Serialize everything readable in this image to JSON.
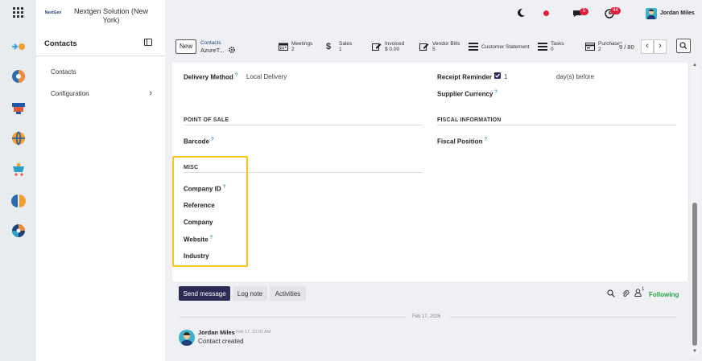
{
  "company": {
    "logo_text": "NextGen",
    "name_line1": "Nextgen Solution (New",
    "name_line2": "York)"
  },
  "sidebar": {
    "title": "Contacts",
    "items": [
      {
        "label": "Contacts"
      },
      {
        "label": "Configuration"
      }
    ]
  },
  "topbar": {
    "chat_badge": "5",
    "activity_badge": "44",
    "user_name": "Jordan Miles"
  },
  "breadcrumb": {
    "new_label": "New",
    "parent": "Contacts",
    "record": "AzureT..."
  },
  "smart_buttons": [
    {
      "label": "Meetings",
      "value": "2",
      "icon": "calendar-icon"
    },
    {
      "label": "Sales",
      "value": "1",
      "icon": "dollar-icon"
    },
    {
      "label": "Invoiced",
      "value": "$ 0.00",
      "icon": "pencil-square-icon"
    },
    {
      "label": "Vendor Bills",
      "value": "5",
      "icon": "pencil-square-icon"
    },
    {
      "label": "Customer Statement",
      "value": "",
      "icon": "list-icon"
    },
    {
      "label": "Tasks",
      "value": "0",
      "icon": "list-icon"
    },
    {
      "label": "Purchases",
      "value": "2",
      "icon": "card-icon"
    }
  ],
  "pager": {
    "text": "9 / 80"
  },
  "form": {
    "delivery_method_label": "Delivery Method",
    "delivery_method_value": "Local Delivery",
    "receipt_reminder_label": "Receipt Reminder",
    "receipt_reminder_value": "1",
    "receipt_reminder_suffix": "day(s) before",
    "supplier_currency_label": "Supplier Currency",
    "pos_section": "POINT OF SALE",
    "fiscal_section": "FISCAL INFORMATION",
    "barcode_label": "Barcode",
    "fiscal_position_label": "Fiscal Position",
    "misc_section": "MISC",
    "company_id_label": "Company ID",
    "reference_label": "Reference",
    "company_label": "Company",
    "website_label": "Website",
    "industry_label": "Industry"
  },
  "chatter": {
    "send_message": "Send message",
    "log_note": "Log note",
    "activities": "Activities",
    "followers_count": "1",
    "following": "Following",
    "date_separator": "Feb 17, 2026",
    "author": "Jordan Miles",
    "timestamp": "Feb 17, 10:01 AM",
    "message": "Contact created"
  },
  "colors": {
    "highlight": "#f5c518",
    "primary": "#2d2b55",
    "following": "#28a745",
    "badge": "#e0203a"
  }
}
